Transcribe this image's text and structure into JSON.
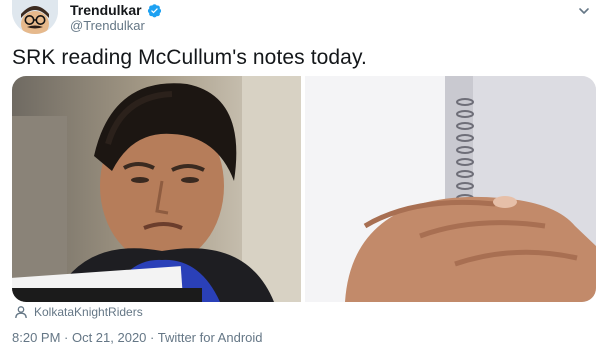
{
  "tweet": {
    "display_name": "Trendulkar",
    "handle": "@Trendulkar",
    "text": "SRK reading McCullum's notes today.",
    "tagged": "KolkataKnightRiders",
    "meta": "8:20 PM · Oct 21, 2020 · Twitter for Android"
  },
  "icons": {
    "verified": "verified-badge-icon",
    "caret": "chevron-down-icon",
    "tag": "person-tag-icon"
  },
  "colors": {
    "verified_blue": "#1da1f2",
    "text_primary": "#14171a",
    "text_secondary": "#657786"
  }
}
